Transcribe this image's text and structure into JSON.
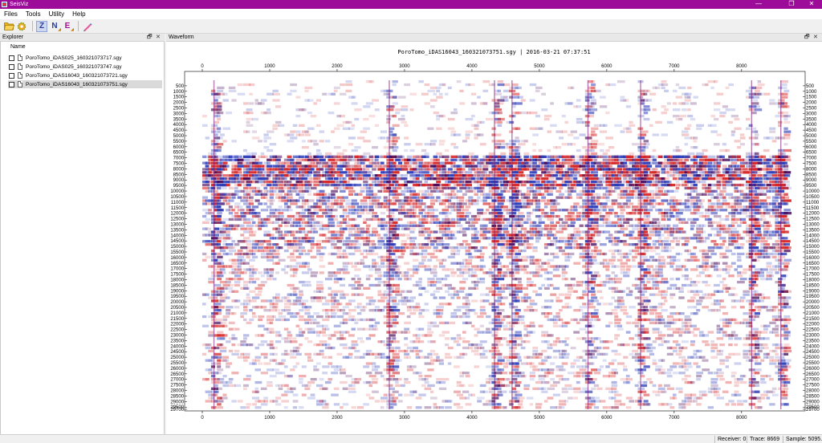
{
  "window": {
    "title": "SeisViz",
    "minimize": "—",
    "maximize": "❐",
    "close": "✕"
  },
  "menu": [
    "Files",
    "Tools",
    "Utility",
    "Help"
  ],
  "toolbar": {
    "open_icon": "folder-open-icon",
    "settings_icon": "gear-icon",
    "z_label": "Z",
    "n_label": "N",
    "e_label": "E",
    "pencil_icon": "pencil-icon"
  },
  "explorer": {
    "title": "Explorer",
    "column_header": "Name",
    "files": [
      "PoroTomo_iDAS025_160321073717.sgy",
      "PoroTomo_iDAS025_160321073747.sgy",
      "PoroTomo_iDAS16043_160321073721.sgy",
      "PoroTomo_iDAS16043_160321073751.sgy"
    ],
    "selected_index": 3,
    "float_icon": "🗗",
    "close_icon": "✕"
  },
  "waveform": {
    "panel_title": "Waveform",
    "plot_title": "PoroTomo_iDAS16043_160321073751.sgy | 2016-03-21 07:37:51",
    "float_icon": "🗗",
    "close_icon": "✕",
    "x_ticks": [
      "0",
      "1000",
      "2000",
      "3000",
      "4000",
      "5000",
      "6000",
      "7000",
      "8000"
    ],
    "y_ticks": [
      "500",
      "1000",
      "1500",
      "2000",
      "2500",
      "3000",
      "3500",
      "4000",
      "4500",
      "5000",
      "5500",
      "6000",
      "6500",
      "7000",
      "7500",
      "8000",
      "8500",
      "9000",
      "9500",
      "10000",
      "10500",
      "11000",
      "11500",
      "12000",
      "12500",
      "13000",
      "13500",
      "14000",
      "14500",
      "15000",
      "15500",
      "16000",
      "16500",
      "17000",
      "17500",
      "18000",
      "18500",
      "19000",
      "19500",
      "20000",
      "20500",
      "21000",
      "21500",
      "22000",
      "22500",
      "23000",
      "23500",
      "24000",
      "24500",
      "25000",
      "25500",
      "26000",
      "26500",
      "27000",
      "27500",
      "28000",
      "28500",
      "29000",
      "29500"
    ],
    "y_last_tick": "29700",
    "colors": {
      "positive": "#d62728",
      "negative": "#2c3cb8",
      "dark": "#4a0a5a"
    }
  },
  "status": {
    "receiver": "Receiver: 0",
    "trace": "Trace: 8669",
    "sample": "Sample: 5095."
  }
}
